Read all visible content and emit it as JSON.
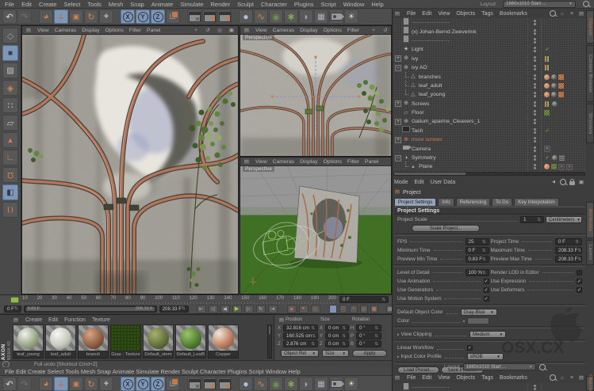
{
  "menubar": {
    "items": [
      "File",
      "Edit",
      "Create",
      "Select",
      "Tools",
      "Mesh",
      "Snap",
      "Animate",
      "Simulate",
      "Render",
      "Sculpt",
      "Character",
      "Plugins",
      "Script",
      "Window",
      "Help"
    ],
    "layout_label": "Layout",
    "layout_value": "1680x1010 Start ..."
  },
  "viewport_menu": {
    "items": [
      "View",
      "Cameras",
      "Display",
      "Options",
      "Filter",
      "Panel"
    ]
  },
  "viewports": {
    "top_right_label": "Perspective",
    "bottom_right_label": "Perspective"
  },
  "timeline": {
    "ticks": [
      "10",
      "20",
      "30",
      "40",
      "50",
      "60",
      "70",
      "80",
      "90",
      "100",
      "110",
      "120",
      "130",
      "140",
      "150",
      "160",
      "170",
      "180",
      "190",
      "200"
    ],
    "frame_field": "0 F",
    "current_frame": "0 F",
    "range_start": "0.83 F",
    "range_end": "208.33 F",
    "end_frame": "208.33 F"
  },
  "materials": {
    "menu": [
      "Create",
      "Edit",
      "Function",
      "Texture"
    ],
    "items": [
      "leaf_young",
      "leaf_adult",
      "branch",
      "Gras - Texture",
      "Default_stem",
      "Default_Leaf5",
      "Copper"
    ]
  },
  "coordinates": {
    "position_label": "Position",
    "size_label": "Size",
    "rotation_label": "Rotation",
    "rows": [
      {
        "a": "X",
        "pos": "32.816 cm",
        "sa": "X",
        "size": "0 cm",
        "ra": "H",
        "rot": "0 °"
      },
      {
        "a": "Y",
        "pos": "160.525 cm",
        "sa": "Y",
        "size": "0 cm",
        "ra": "P",
        "rot": "0 °"
      },
      {
        "a": "Z",
        "pos": "2.876 cm",
        "sa": "Z",
        "size": "0 cm",
        "ra": "B",
        "rot": "0 °"
      }
    ],
    "mode_dropdown": "Object Rel",
    "size_dropdown": "Size",
    "apply_button": "Apply"
  },
  "status_bar": {
    "text": "Full undo [Shortcut Cmd+Z]"
  },
  "object_manager": {
    "menu": [
      "File",
      "Edit",
      "View",
      "Objects",
      "Tags",
      "Bookmarks"
    ],
    "rows": [
      {
        "name": "·····················"
      },
      {
        "name": "(x) Johan-Bernd Zweverink"
      },
      {
        "name": "·····················"
      },
      {
        "name": "Light"
      },
      {
        "name": "ivy"
      },
      {
        "name": "ivy AO"
      },
      {
        "name": "branches"
      },
      {
        "name": "leaf_adult"
      },
      {
        "name": "leaf_young"
      },
      {
        "name": "Screws"
      },
      {
        "name": "Floor"
      },
      {
        "name": "Galium_aparine_Cleavers_1"
      },
      {
        "name": "Tash"
      },
      {
        "name": "more screws"
      },
      {
        "name": "Camera"
      },
      {
        "name": "Symmetry"
      },
      {
        "name": "Plane"
      }
    ]
  },
  "right_tabs": {
    "objects": "Objects",
    "content_browser": "Content Browser",
    "structure": "Structure",
    "attributes": "Attributes",
    "layers": "Layers"
  },
  "attributes": {
    "menu": [
      "Mode",
      "Edit",
      "User Data"
    ],
    "object_label": "Project",
    "tabs": [
      "Project Settings",
      "Info",
      "Referencing",
      "To Do",
      "Key Interpolation"
    ],
    "section": "Project Settings",
    "project_scale_label": "Project Scale",
    "project_scale_value": "1",
    "project_scale_unit": "Centimeters",
    "scale_project_button": "Scale Project...",
    "fps_label": "FPS",
    "fps_value": "25",
    "project_time_label": "Project Time",
    "project_time_value": "0 F",
    "minimum_time_label": "Minimum Time",
    "minimum_time_value": "0 F",
    "maximum_time_label": "Maximum Time",
    "maximum_time_value": "208.33 F",
    "preview_min_label": "Preview Min Time",
    "preview_min_value": "0.83 F",
    "preview_max_label": "Preview Max Time",
    "preview_max_value": "208.33 F",
    "lod_label": "Level of Detail",
    "lod_value": "100 %",
    "render_lod_label": "Render LOD in Editor",
    "use_animation_label": "Use Animation",
    "use_expression_label": "Use Expression",
    "use_generators_label": "Use Generators",
    "use_deformers_label": "Use Deformers",
    "use_motion_label": "Use Motion System",
    "default_color_label": "Default Object Color",
    "default_color_value": "Gray-Blue",
    "color_label": "Color",
    "view_clipping_label": "View Clipping",
    "view_clipping_value": "Medium",
    "linear_workflow_label": "Linear Workflow",
    "input_profile_label": "Input Color Profile",
    "input_profile_value": "sRGB",
    "load_preset_button": "Load Preset...",
    "save_preset_button": "Save Preset..."
  },
  "branding": {
    "maxon_line1": "MAXON",
    "maxon_line2": "CINEMA 4D",
    "watermark": "OSX.CX"
  },
  "colors": {
    "accent_orange": "#cf8350",
    "selection_blue": "#7f97b6",
    "play_green": "#9ccf52",
    "marker_green": "#8fba4d"
  }
}
